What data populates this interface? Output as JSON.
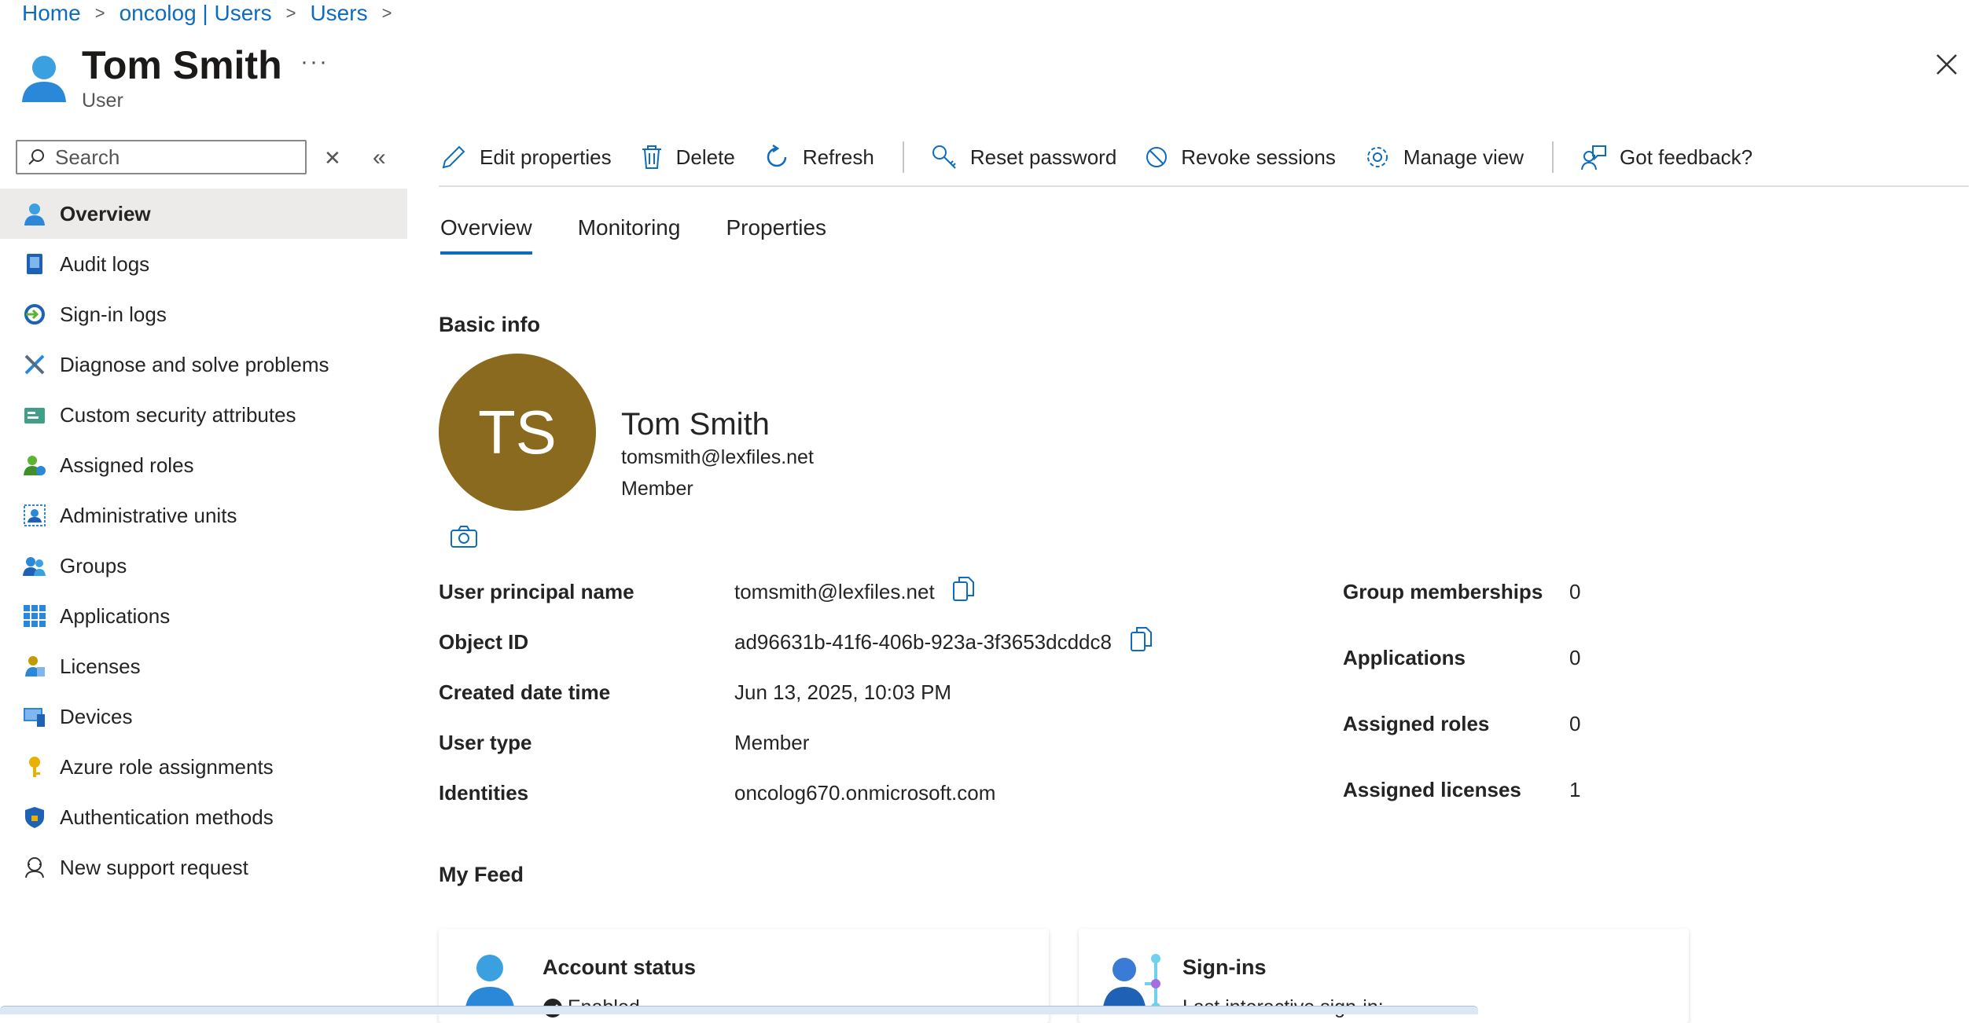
{
  "breadcrumb": [
    "Home",
    "oncolog | Users",
    "Users"
  ],
  "header": {
    "title": "Tom Smith",
    "subtitle": "User",
    "more": "···"
  },
  "search": {
    "placeholder": "Search"
  },
  "sidebar": {
    "items": [
      {
        "label": "Overview",
        "icon": "user-icon",
        "active": true
      },
      {
        "label": "Audit logs",
        "icon": "audit-log-icon"
      },
      {
        "label": "Sign-in logs",
        "icon": "sign-in-icon"
      },
      {
        "label": "Diagnose and solve problems",
        "icon": "wrench-icon"
      },
      {
        "label": "Custom security attributes",
        "icon": "security-attributes-icon"
      },
      {
        "label": "Assigned roles",
        "icon": "roles-icon"
      },
      {
        "label": "Administrative units",
        "icon": "admin-units-icon"
      },
      {
        "label": "Groups",
        "icon": "groups-icon"
      },
      {
        "label": "Applications",
        "icon": "apps-grid-icon"
      },
      {
        "label": "Licenses",
        "icon": "license-icon"
      },
      {
        "label": "Devices",
        "icon": "device-icon"
      },
      {
        "label": "Azure role assignments",
        "icon": "key-icon"
      },
      {
        "label": "Authentication methods",
        "icon": "shield-icon"
      },
      {
        "label": "New support request",
        "icon": "support-icon"
      }
    ]
  },
  "toolbar": {
    "edit": "Edit properties",
    "delete": "Delete",
    "refresh": "Refresh",
    "reset": "Reset password",
    "revoke": "Revoke sessions",
    "manage": "Manage view",
    "feedback": "Got feedback?"
  },
  "tabs": [
    "Overview",
    "Monitoring",
    "Properties"
  ],
  "basic_info": {
    "heading": "Basic info",
    "initials": "TS",
    "name": "Tom Smith",
    "email": "tomsmith@lexfiles.net",
    "type": "Member",
    "avatar_color": "#8a6a1f"
  },
  "details": {
    "upn_label": "User principal name",
    "upn": "tomsmith@lexfiles.net",
    "oid_label": "Object ID",
    "oid": "ad96631b-41f6-406b-923a-3f3653dcddc8",
    "created_label": "Created date time",
    "created": "Jun 13, 2025, 10:03 PM",
    "usertype_label": "User type",
    "usertype": "Member",
    "identities_label": "Identities",
    "identities": "oncolog670.onmicrosoft.com"
  },
  "stats": {
    "groups_label": "Group memberships",
    "groups": "0",
    "apps_label": "Applications",
    "apps": "0",
    "roles_label": "Assigned roles",
    "roles": "0",
    "licenses_label": "Assigned licenses",
    "licenses": "1"
  },
  "feed": {
    "heading": "My Feed",
    "account_title": "Account status",
    "account_status": "Enabled",
    "signins_title": "Sign-ins",
    "signins_sub": "Last interactive sign-in:"
  },
  "colors": {
    "accent": "#0f6cbd",
    "active_nav": "#edebe9"
  }
}
